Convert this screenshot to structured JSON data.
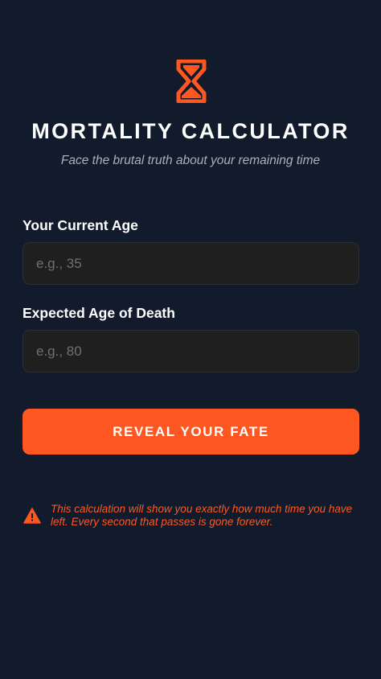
{
  "header": {
    "logo_icon": "hourglass-icon",
    "title": "MORTALITY CALCULATOR",
    "subtitle": "Face the brutal truth about your remaining time"
  },
  "form": {
    "current_age": {
      "label": "Your Current Age",
      "value": "",
      "placeholder": "e.g., 35"
    },
    "death_age": {
      "label": "Expected Age of Death",
      "value": "",
      "placeholder": "e.g., 80"
    },
    "submit_label": "REVEAL YOUR FATE"
  },
  "warning": {
    "icon": "warning-triangle-icon",
    "text": "This calculation will show you exactly how much time you have left. Every second that passes is gone forever."
  },
  "colors": {
    "background": "#111b2b",
    "accent": "#ff5722",
    "input_bg": "#1f1f1f",
    "subtitle": "#a9b0bc"
  }
}
